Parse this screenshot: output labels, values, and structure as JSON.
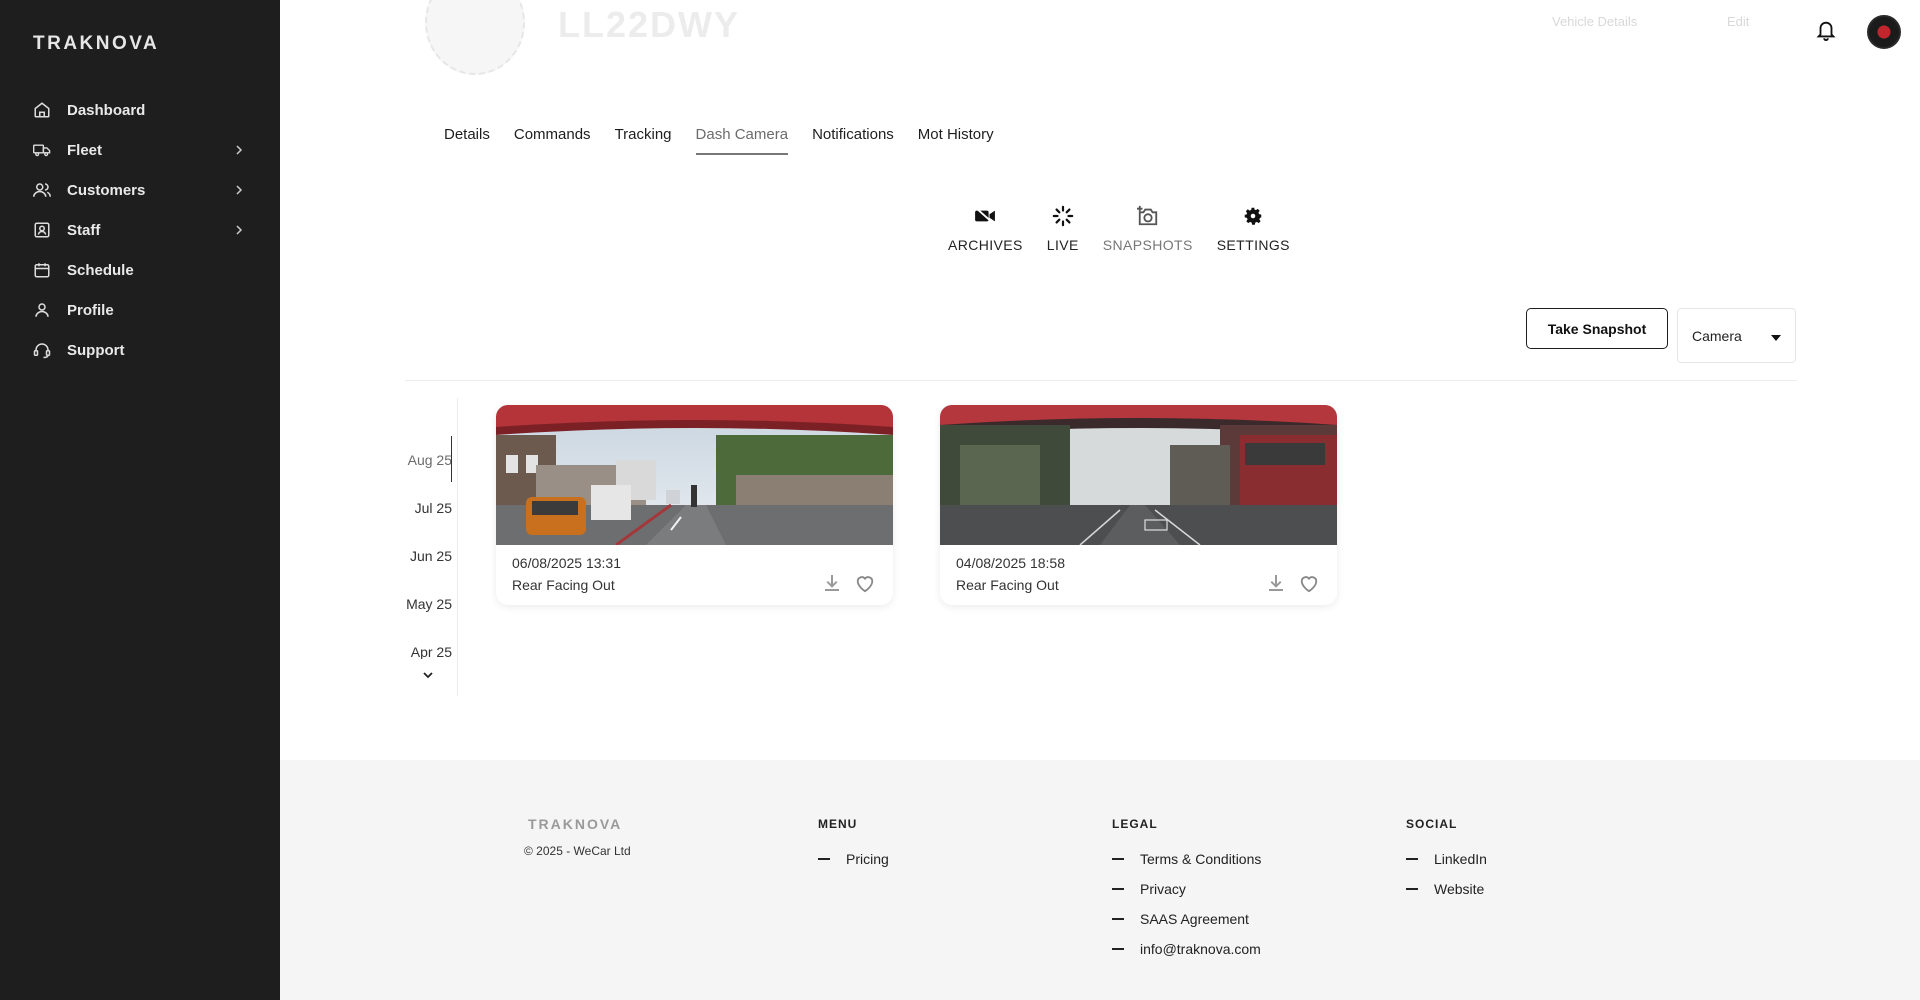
{
  "sidebar": {
    "brand": "TRAKNOVA",
    "items": [
      {
        "label": "Dashboard",
        "icon": "home-icon",
        "chevron": false
      },
      {
        "label": "Fleet",
        "icon": "truck-icon",
        "chevron": true
      },
      {
        "label": "Customers",
        "icon": "users-icon",
        "chevron": true
      },
      {
        "label": "Staff",
        "icon": "id-badge-icon",
        "chevron": true
      },
      {
        "label": "Schedule",
        "icon": "calendar-icon",
        "chevron": false
      },
      {
        "label": "Profile",
        "icon": "user-icon",
        "chevron": false
      },
      {
        "label": "Support",
        "icon": "headset-icon",
        "chevron": false
      }
    ]
  },
  "header": {
    "plate": "LL22DWY",
    "link1": "Vehicle Details",
    "link2": "Edit"
  },
  "tabs": [
    "Details",
    "Commands",
    "Tracking",
    "Dash Camera",
    "Notifications",
    "Mot History"
  ],
  "active_tab": "Dash Camera",
  "subnav": [
    {
      "label": "ARCHIVES",
      "icon": "video-camera-icon"
    },
    {
      "label": "LIVE",
      "icon": "loading-spinner-icon"
    },
    {
      "label": "SNAPSHOTS",
      "icon": "add-photo-icon"
    },
    {
      "label": "SETTINGS",
      "icon": "gear-icon"
    }
  ],
  "active_subnav": "SNAPSHOTS",
  "controls": {
    "take_snapshot": "Take Snapshot",
    "camera_select": "Camera"
  },
  "timeline": {
    "months": [
      "Aug 25",
      "Jul 25",
      "Jun 25",
      "May 25",
      "Apr 25"
    ],
    "active": "Aug 25"
  },
  "snapshots": [
    {
      "timestamp": "06/08/2025 13:31",
      "camera": "Rear Facing Out"
    },
    {
      "timestamp": "04/08/2025 18:58",
      "camera": "Rear Facing Out"
    }
  ],
  "footer": {
    "brand": "TRAKNOVA",
    "copyright": "© 2025 - WeCar Ltd",
    "menu": {
      "title": "MENU",
      "links": [
        "Pricing"
      ]
    },
    "legal": {
      "title": "LEGAL",
      "links": [
        "Terms & Conditions",
        "Privacy",
        "SAAS Agreement",
        "info@traknova.com"
      ]
    },
    "social": {
      "title": "SOCIAL",
      "links": [
        "LinkedIn",
        "Website"
      ]
    }
  },
  "colors": {
    "sidebar_bg": "#1e1e1e",
    "footer_bg": "#f5f5f5",
    "accent_bus_red": "#c0262c"
  }
}
